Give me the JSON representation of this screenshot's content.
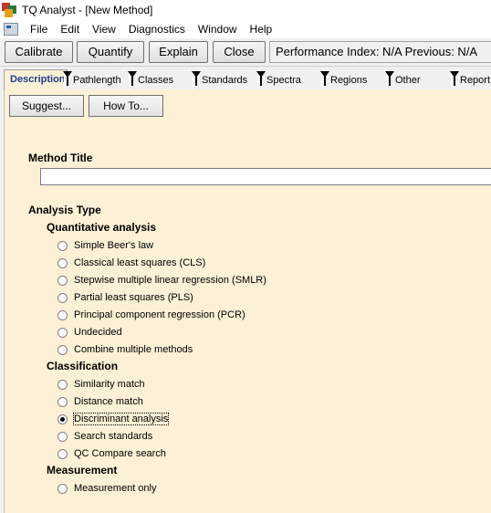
{
  "window": {
    "title": "TQ Analyst  - [New Method]"
  },
  "menu": [
    "File",
    "Edit",
    "View",
    "Diagnostics",
    "Window",
    "Help"
  ],
  "toolbar": {
    "calibrate": "Calibrate",
    "quantify": "Quantify",
    "explain": "Explain",
    "close": "Close",
    "performance": "Performance Index:  N/A  Previous:  N/A"
  },
  "tabs": [
    "Description",
    "Pathlength",
    "Classes",
    "Standards",
    "Spectra",
    "Regions",
    "Other",
    "Report"
  ],
  "buttons": {
    "suggest": "Suggest...",
    "howto": "How To..."
  },
  "method_title": {
    "label": "Method Title",
    "value": ""
  },
  "analysis_type": {
    "label": "Analysis Type",
    "quantitative": {
      "label": "Quantitative analysis",
      "options": [
        "Simple Beer's law",
        "Classical least squares (CLS)",
        "Stepwise multiple linear regression (SMLR)",
        "Partial least squares (PLS)",
        "Principal component regression (PCR)",
        "Undecided",
        "Combine multiple methods"
      ]
    },
    "classification": {
      "label": "Classification",
      "options": [
        "Similarity match",
        "Distance match",
        "Discriminant analysis",
        "Search standards",
        "QC Compare search"
      ],
      "selected": "Discriminant analysis"
    },
    "measurement": {
      "label": "Measurement",
      "options": [
        "Measurement only"
      ]
    }
  }
}
